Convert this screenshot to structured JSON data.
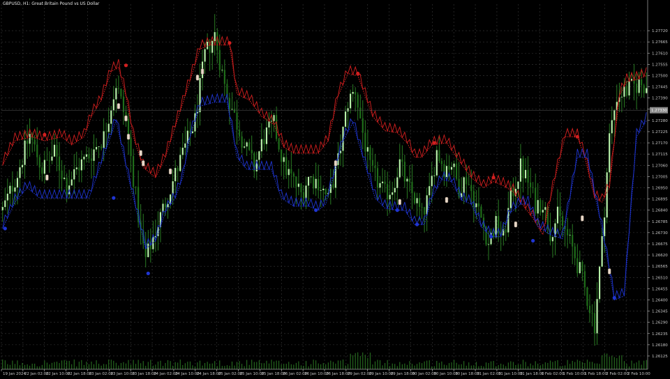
{
  "window": {
    "symbol_title": "GBPUSD, H1:  Great Britain Pound vs US Dollar"
  },
  "colors": {
    "background": "#000000",
    "grid": "#3a3a3a",
    "axis_text": "#c8c8c8",
    "bull_body": "#b6f0a8",
    "bear_body": "#1f6e1a",
    "wick": "#2f8a28",
    "upper_band": "#d21f1f",
    "lower_band": "#1f35d2",
    "volume": "#2c7a24",
    "price_tag_bg": "#8a8a8a"
  },
  "chart_data": {
    "type": "candlestick",
    "current_price_label": "1.27330",
    "ylim": [
      1.2606,
      1.2785
    ],
    "y_ticks": [
      "1.27720",
      "1.27665",
      "1.27610",
      "1.27555",
      "1.27500",
      "1.27445",
      "1.27390",
      "1.27335",
      "1.27280",
      "1.27225",
      "1.27170",
      "1.27115",
      "1.27060",
      "1.27005",
      "1.26950",
      "1.26895",
      "1.26840",
      "1.26785",
      "1.26730",
      "1.26675",
      "1.26620",
      "1.26565",
      "1.26510",
      "1.26455",
      "1.26400",
      "1.26345",
      "1.26290",
      "1.26235",
      "1.26180",
      "1.26125"
    ],
    "x_ticks": [
      "19 Jan 2024",
      "22 Jan 02:00",
      "22 Jan 10:00",
      "22 Jan 18:00",
      "23 Jan 02:00",
      "23 Jan 10:00",
      "23 Jan 18:00",
      "24 Jan 02:00",
      "24 Jan 10:00",
      "24 Jan 18:00",
      "25 Jan 02:00",
      "25 Jan 10:00",
      "25 Jan 18:00",
      "26 Jan 02:00",
      "26 Jan 10:00",
      "26 Jan 18:00",
      "29 Jan 02:00",
      "29 Jan 10:00",
      "29 Jan 18:00",
      "30 Jan 02:00",
      "30 Jan 10:00",
      "30 Jan 18:00",
      "31 Jan 02:00",
      "31 Jan 10:00",
      "31 Jan 18:00",
      "1 Feb 02:00",
      "1 Feb 10:00",
      "1 Feb 18:00",
      "2 Feb 02:00",
      "2 Feb 10:00"
    ],
    "price_path": [
      [
        0,
        1.2684
      ],
      [
        6,
        1.2702
      ],
      [
        11,
        1.2721
      ],
      [
        16,
        1.2704
      ],
      [
        21,
        1.2712
      ],
      [
        26,
        1.2696
      ],
      [
        31,
        1.2706
      ],
      [
        36,
        1.2712
      ],
      [
        41,
        1.272
      ],
      [
        46,
        1.2746
      ],
      [
        50,
        1.2728
      ],
      [
        53,
        1.27
      ],
      [
        56,
        1.2672
      ],
      [
        58,
        1.266
      ],
      [
        62,
        1.2674
      ],
      [
        66,
        1.2688
      ],
      [
        71,
        1.2705
      ],
      [
        74,
        1.2715
      ],
      [
        78,
        1.2728
      ],
      [
        82,
        1.276
      ],
      [
        86,
        1.277
      ],
      [
        90,
        1.2745
      ],
      [
        94,
        1.273
      ],
      [
        98,
        1.2716
      ],
      [
        102,
        1.2705
      ],
      [
        106,
        1.272
      ],
      [
        110,
        1.2726
      ],
      [
        114,
        1.2706
      ],
      [
        118,
        1.2698
      ],
      [
        121,
        1.2692
      ],
      [
        124,
        1.27
      ],
      [
        128,
        1.2698
      ],
      [
        132,
        1.2689
      ],
      [
        136,
        1.2708
      ],
      [
        140,
        1.2737
      ],
      [
        143,
        1.2743
      ],
      [
        146,
        1.2722
      ],
      [
        149,
        1.2704
      ],
      [
        152,
        1.2698
      ],
      [
        155,
        1.2692
      ],
      [
        158,
        1.2695
      ],
      [
        161,
        1.2707
      ],
      [
        164,
        1.2696
      ],
      [
        167,
        1.269
      ],
      [
        170,
        1.2681
      ],
      [
        173,
        1.2692
      ],
      [
        176,
        1.2713
      ],
      [
        179,
        1.2705
      ],
      [
        182,
        1.2707
      ],
      [
        185,
        1.2695
      ],
      [
        188,
        1.27
      ],
      [
        191,
        1.269
      ],
      [
        194,
        1.268
      ],
      [
        197,
        1.2668
      ],
      [
        200,
        1.2677
      ],
      [
        203,
        1.267
      ],
      [
        206,
        1.269
      ],
      [
        210,
        1.2705
      ],
      [
        213,
        1.2698
      ],
      [
        216,
        1.2687
      ],
      [
        219,
        1.2688
      ],
      [
        222,
        1.2673
      ],
      [
        225,
        1.2681
      ],
      [
        228,
        1.2674
      ],
      [
        231,
        1.2665
      ],
      [
        234,
        1.2654
      ],
      [
        237,
        1.2641
      ],
      [
        240,
        1.2628
      ],
      [
        243,
        1.2668
      ],
      [
        246,
        1.272
      ],
      [
        249,
        1.274
      ],
      [
        252,
        1.2742
      ],
      [
        255,
        1.2744
      ],
      [
        258,
        1.2746
      ],
      [
        261,
        1.2745
      ]
    ],
    "upper_band": [
      [
        0,
        1.2706
      ],
      [
        5,
        1.2718
      ],
      [
        12,
        1.272
      ],
      [
        17,
        1.2718
      ],
      [
        24,
        1.272
      ],
      [
        28,
        1.2716
      ],
      [
        33,
        1.272
      ],
      [
        36,
        1.273
      ],
      [
        40,
        1.2738
      ],
      [
        44,
        1.2752
      ],
      [
        47,
        1.2754
      ],
      [
        50,
        1.274
      ],
      [
        53,
        1.272
      ],
      [
        57,
        1.2705
      ],
      [
        62,
        1.27
      ],
      [
        66,
        1.271
      ],
      [
        70,
        1.2725
      ],
      [
        74,
        1.274
      ],
      [
        80,
        1.2763
      ],
      [
        84,
        1.2765
      ],
      [
        92,
        1.2765
      ],
      [
        95,
        1.2741
      ],
      [
        100,
        1.2738
      ],
      [
        105,
        1.273
      ],
      [
        110,
        1.2726
      ],
      [
        114,
        1.2715
      ],
      [
        118,
        1.2712
      ],
      [
        128,
        1.2712
      ],
      [
        132,
        1.2718
      ],
      [
        136,
        1.274
      ],
      [
        140,
        1.2751
      ],
      [
        144,
        1.275
      ],
      [
        150,
        1.273
      ],
      [
        155,
        1.2723
      ],
      [
        160,
        1.2722
      ],
      [
        164,
        1.2717
      ],
      [
        167,
        1.271
      ],
      [
        170,
        1.271
      ],
      [
        174,
        1.2716
      ],
      [
        180,
        1.2717
      ],
      [
        184,
        1.271
      ],
      [
        190,
        1.27
      ],
      [
        195,
        1.2695
      ],
      [
        199,
        1.2698
      ],
      [
        203,
        1.2696
      ],
      [
        207,
        1.2693
      ],
      [
        210,
        1.2688
      ],
      [
        215,
        1.268
      ],
      [
        219,
        1.2672
      ],
      [
        224,
        1.27
      ],
      [
        228,
        1.272
      ],
      [
        233,
        1.272
      ],
      [
        236,
        1.271
      ],
      [
        240,
        1.269
      ],
      [
        243,
        1.2688
      ],
      [
        246,
        1.2695
      ],
      [
        250,
        1.274
      ],
      [
        253,
        1.2747
      ],
      [
        257,
        1.2748
      ],
      [
        261,
        1.275
      ]
    ],
    "lower_band": [
      [
        0,
        1.2675
      ],
      [
        5,
        1.2688
      ],
      [
        10,
        1.2695
      ],
      [
        15,
        1.269
      ],
      [
        21,
        1.269
      ],
      [
        26,
        1.269
      ],
      [
        31,
        1.269
      ],
      [
        35,
        1.269
      ],
      [
        38,
        1.27
      ],
      [
        42,
        1.2714
      ],
      [
        46,
        1.2728
      ],
      [
        51,
        1.27
      ],
      [
        55,
        1.268
      ],
      [
        58,
        1.2665
      ],
      [
        62,
        1.2669
      ],
      [
        66,
        1.2683
      ],
      [
        70,
        1.269
      ],
      [
        73,
        1.27
      ],
      [
        76,
        1.272
      ],
      [
        80,
        1.2735
      ],
      [
        86,
        1.2737
      ],
      [
        91,
        1.2737
      ],
      [
        95,
        1.271
      ],
      [
        99,
        1.2704
      ],
      [
        103,
        1.2704
      ],
      [
        109,
        1.2704
      ],
      [
        113,
        1.269
      ],
      [
        118,
        1.2686
      ],
      [
        124,
        1.2686
      ],
      [
        128,
        1.2684
      ],
      [
        131,
        1.2687
      ],
      [
        134,
        1.27
      ],
      [
        138,
        1.2718
      ],
      [
        142,
        1.2727
      ],
      [
        147,
        1.2706
      ],
      [
        151,
        1.269
      ],
      [
        155,
        1.2685
      ],
      [
        160,
        1.2684
      ],
      [
        163,
        1.2684
      ],
      [
        167,
        1.2677
      ],
      [
        171,
        1.2677
      ],
      [
        174,
        1.269
      ],
      [
        178,
        1.2699
      ],
      [
        182,
        1.2698
      ],
      [
        186,
        1.2689
      ],
      [
        190,
        1.2687
      ],
      [
        194,
        1.2676
      ],
      [
        198,
        1.2671
      ],
      [
        202,
        1.2671
      ],
      [
        206,
        1.2683
      ],
      [
        210,
        1.2687
      ],
      [
        213,
        1.2687
      ],
      [
        217,
        1.2676
      ],
      [
        222,
        1.2672
      ],
      [
        227,
        1.267
      ],
      [
        230,
        1.269
      ],
      [
        233,
        1.271
      ],
      [
        237,
        1.271
      ],
      [
        240,
        1.2692
      ],
      [
        243,
        1.2675
      ],
      [
        248,
        1.264
      ],
      [
        252,
        1.2642
      ],
      [
        257,
        1.272
      ],
      [
        261,
        1.2728
      ]
    ],
    "upper_signals": [
      [
        17,
        1.2721
      ],
      [
        50,
        1.2755
      ],
      [
        92,
        1.2766
      ],
      [
        144,
        1.2751
      ],
      [
        175,
        1.2717
      ],
      [
        199,
        1.27
      ],
      [
        233,
        1.272
      ]
    ],
    "lower_signals": [
      [
        1,
        1.2675
      ],
      [
        45,
        1.269
      ],
      [
        59,
        1.2653
      ],
      [
        127,
        1.2684
      ],
      [
        160,
        1.2684
      ],
      [
        168,
        1.2677
      ],
      [
        198,
        1.2671
      ],
      [
        215,
        1.2669
      ],
      [
        248,
        1.2641
      ]
    ],
    "price_labels": [
      [
        18,
        1.27
      ],
      [
        47,
        1.2735
      ],
      [
        50,
        1.2729
      ],
      [
        51,
        1.272
      ],
      [
        56,
        1.2712
      ],
      [
        57,
        1.2707
      ],
      [
        68,
        1.2703
      ],
      [
        79,
        1.2749
      ],
      [
        81,
        1.2752
      ],
      [
        135,
        1.2707
      ],
      [
        161,
        1.2688
      ],
      [
        180,
        1.2689
      ],
      [
        208,
        1.2677
      ],
      [
        235,
        1.268
      ],
      [
        246,
        1.2654
      ]
    ]
  }
}
